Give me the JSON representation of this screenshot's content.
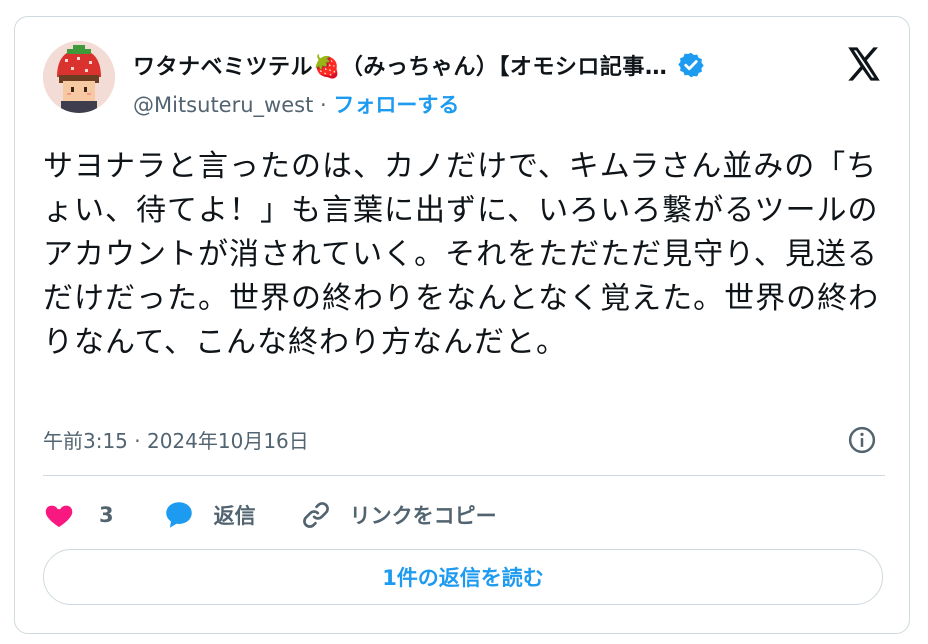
{
  "author": {
    "display_name": "ワタナベミツテル🍓（みっちゃん）【オモシロ記事…",
    "handle": "@Mitsuteru_west",
    "separator": "·",
    "follow_label": "フォローする"
  },
  "tweet": {
    "text": "サヨナラと言ったのは、カノだけで、キムラさん並みの「ちょい、待てよ！」も言葉に出ずに、いろいろ繋がるツールのアカウントが消されていく。それをただただ見守り、見送るだけだった。世界の終わりをなんとなく覚えた。世界の終わりなんて、こんな終わり方なんだと。",
    "timestamp": "午前3:15 · 2024年10月16日"
  },
  "actions": {
    "like_count": "3",
    "reply_label": "返信",
    "copy_link_label": "リンクをコピー"
  },
  "read_replies_label": "1件の返信を読む",
  "colors": {
    "accent": "#1d9bf0",
    "like": "#f91880",
    "muted": "#536471",
    "border": "#cfd9de"
  },
  "icons": [
    "verified-badge-icon",
    "x-logo-icon",
    "info-icon",
    "heart-icon",
    "reply-bubble-icon",
    "link-icon"
  ]
}
